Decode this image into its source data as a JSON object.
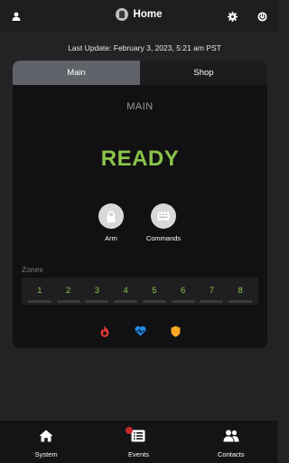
{
  "header": {
    "title": "Home",
    "left_icon": "user-icon",
    "right_icons": [
      "gear-icon",
      "power-icon"
    ]
  },
  "last_update": "Last Update: February 3, 2023, 5:21 am PST",
  "tabs": [
    {
      "label": "Main",
      "active": true
    },
    {
      "label": "Shop",
      "active": false
    }
  ],
  "panel": {
    "title": "MAIN",
    "status": "READY",
    "status_color": "#8bc34a",
    "actions": [
      {
        "label": "Arm",
        "icon": "lock-icon"
      },
      {
        "label": "Commands",
        "icon": "keypad-icon"
      }
    ]
  },
  "zones": {
    "label": "Zones",
    "items": [
      "1",
      "2",
      "3",
      "4",
      "5",
      "6",
      "7",
      "8"
    ]
  },
  "status_icons": [
    {
      "name": "fire-icon",
      "color": "#e53935"
    },
    {
      "name": "medical-icon",
      "color": "#1e88e5"
    },
    {
      "name": "police-icon",
      "color": "#f9a825"
    }
  ],
  "bottom_nav": [
    {
      "label": "System",
      "icon": "home-icon"
    },
    {
      "label": "Events",
      "icon": "list-icon",
      "badge": true
    },
    {
      "label": "Contacts",
      "icon": "people-icon"
    }
  ]
}
